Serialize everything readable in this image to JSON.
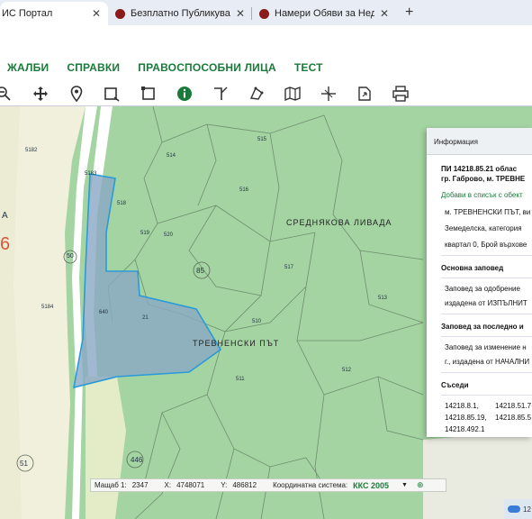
{
  "browser": {
    "tabs": [
      {
        "title": "ИС Портал",
        "active": true
      },
      {
        "title": "Безплатно Публикуване на Об",
        "active": false
      },
      {
        "title": "Намери Обяви за Недвижим",
        "active": false
      }
    ],
    "new_tab": "+"
  },
  "menu": {
    "items": [
      "ЖАЛБИ",
      "СПРАВКИ",
      "ПРАВОСПОСОБНИ ЛИЦА",
      "ТЕСТ"
    ]
  },
  "toolbar": {
    "icons": [
      "zoom-out-icon",
      "pan-icon",
      "location-pin-icon",
      "select-box-icon",
      "select-area-icon",
      "info-icon",
      "measure-line-icon",
      "measure-area-icon",
      "polygon-tool-icon",
      "map-layers-icon",
      "coordinates-icon",
      "export-icon",
      "print-icon"
    ]
  },
  "map": {
    "labels": {
      "region_name": "СРЕДНЯКОВА ЛИВАДА",
      "road_name": "ТРЕВНЕНСКИ ПЪТ",
      "parcel_85": "85",
      "parcel_446": "446",
      "parcel_51": "51",
      "parcel_6": "6",
      "parcel_a": "А",
      "n5182": "5182",
      "n5183": "5183",
      "n5184": "5184",
      "n518": "518",
      "n519": "519",
      "n520": "520",
      "n515": "515",
      "n516": "516",
      "n517": "517",
      "n514": "514",
      "n21": "21",
      "n640": "640",
      "n50": "50",
      "n511": "511",
      "n510": "510",
      "n512": "512",
      "n513": "513"
    },
    "colors": {
      "forest": "#a4d4a1",
      "field": "#f1f0dc",
      "road": "#ffffff",
      "selection": "#8aa8c4",
      "selection_border": "#2a9ad8"
    }
  },
  "info_panel": {
    "header": "Информация",
    "title_line1": "ПИ 14218.85.21 облас",
    "title_line2": "гр. Габрово, м. ТРЕВНЕ",
    "add_link": "Добави в списък с обект",
    "details": [
      "м. ТРЕВНЕНСКИ ПЪТ, ви",
      "Земеделска, категория",
      "квартал 0, Брой върхове"
    ],
    "section_main_order": "Основна заповед",
    "main_order_text": [
      "Заповед  за  одобрение",
      "издадена от ИЗПЪЛНИТ"
    ],
    "section_last_order": "Заповед за последно и",
    "last_order_text": [
      "Заповед за изменение н",
      "г., издадена от НАЧАЛНИ"
    ],
    "section_neighbors": "Съседи",
    "neighbors": [
      [
        "14218.8.1,",
        "14218.51.7"
      ],
      [
        "14218.85.19,",
        "14218.85.5"
      ],
      [
        "14218.492.1",
        ""
      ]
    ]
  },
  "status_bar": {
    "scale_label": "Мащаб 1:",
    "scale_value": "2347",
    "x_label": "X:",
    "x_value": "4748071",
    "y_label": "Y:",
    "y_value": "486812",
    "cs_label": "Координатна система:",
    "cs_value": "ККС 2005",
    "dropdown": "▼",
    "search": "⊕"
  },
  "tray": {
    "text": "12"
  }
}
